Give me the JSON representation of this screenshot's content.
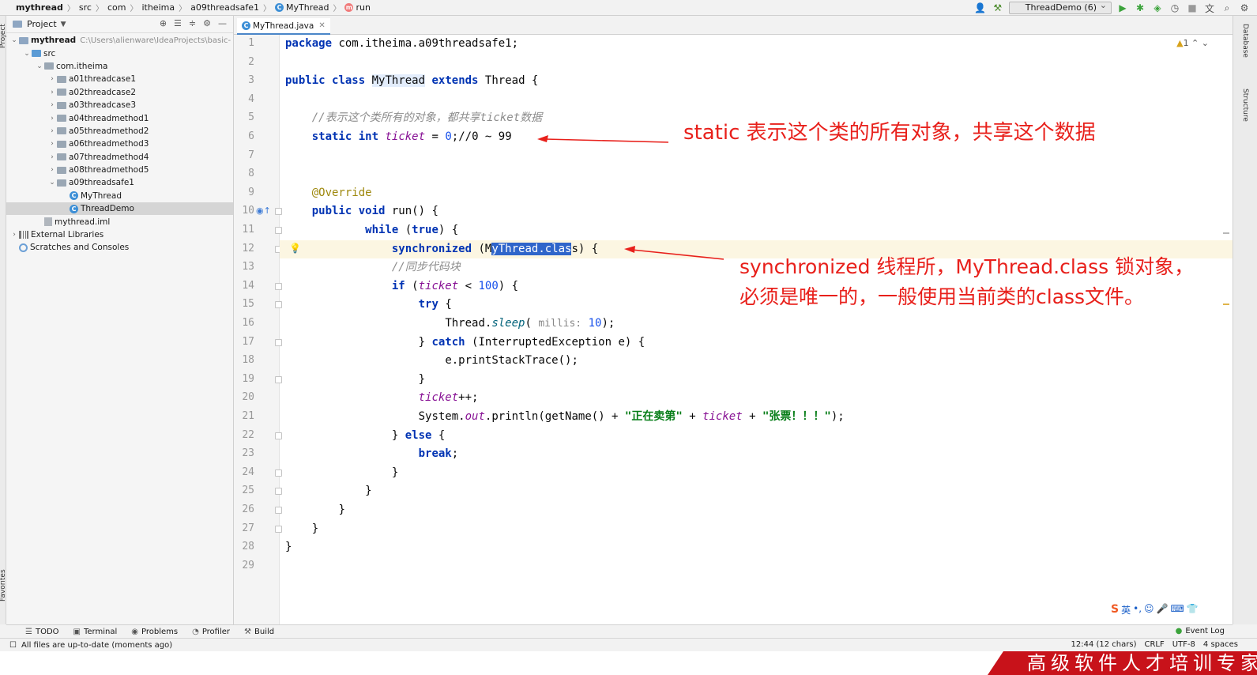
{
  "breadcrumb": [
    "mythread",
    "src",
    "com",
    "itheima",
    "a09threadsafe1",
    "MyThread",
    "run"
  ],
  "run_config": "ThreadDemo (6)",
  "project_panel": {
    "title": "Project",
    "root": {
      "name": "mythread",
      "path": "C:\\Users\\alienware\\IdeaProjects\\basic-"
    },
    "tree": [
      {
        "label": "src",
        "depth": 1,
        "type": "folder-blue",
        "expanded": true
      },
      {
        "label": "com.itheima",
        "depth": 2,
        "type": "pkg",
        "expanded": true
      },
      {
        "label": "a01threadcase1",
        "depth": 3,
        "type": "pkg",
        "expanded": false
      },
      {
        "label": "a02threadcase2",
        "depth": 3,
        "type": "pkg",
        "expanded": false
      },
      {
        "label": "a03threadcase3",
        "depth": 3,
        "type": "pkg",
        "expanded": false
      },
      {
        "label": "a04threadmethod1",
        "depth": 3,
        "type": "pkg",
        "expanded": false
      },
      {
        "label": "a05threadmethod2",
        "depth": 3,
        "type": "pkg",
        "expanded": false
      },
      {
        "label": "a06threadmethod3",
        "depth": 3,
        "type": "pkg",
        "expanded": false
      },
      {
        "label": "a07threadmethod4",
        "depth": 3,
        "type": "pkg",
        "expanded": false
      },
      {
        "label": "a08threadmethod5",
        "depth": 3,
        "type": "pkg",
        "expanded": false
      },
      {
        "label": "a09threadsafe1",
        "depth": 3,
        "type": "pkg",
        "expanded": true
      },
      {
        "label": "MyThread",
        "depth": 4,
        "type": "class"
      },
      {
        "label": "ThreadDemo",
        "depth": 4,
        "type": "class",
        "selected": true
      },
      {
        "label": "mythread.iml",
        "depth": 2,
        "type": "iml"
      },
      {
        "label": "External Libraries",
        "depth": 0,
        "type": "lib",
        "expanded": false
      },
      {
        "label": "Scratches and Consoles",
        "depth": 0,
        "type": "scratch"
      }
    ]
  },
  "editor": {
    "tab": "MyThread.java",
    "warnings": "1",
    "line_numbers": [
      "1",
      "2",
      "3",
      "4",
      "5",
      "6",
      "7",
      "8",
      "9",
      "10",
      "11",
      "12",
      "13",
      "14",
      "15",
      "16",
      "17",
      "18",
      "19",
      "20",
      "21",
      "22",
      "23",
      "24",
      "25",
      "26",
      "27",
      "28",
      "29"
    ]
  },
  "code": {
    "l1": [
      "package",
      " com.itheima.a09threadsafe1;"
    ],
    "l3": [
      "public",
      " ",
      "class",
      " ",
      "MyThread",
      " ",
      "extends",
      " Thread {"
    ],
    "l5": "//表示这个类所有的对象，都共享ticket数据",
    "l6": [
      "static",
      " ",
      "int",
      " ",
      "ticket",
      " = ",
      "0",
      ";//0 ~ 99"
    ],
    "l9": "@Override",
    "l10": [
      "public",
      " ",
      "void",
      " run() {"
    ],
    "l11": [
      "while",
      " (",
      "true",
      ") {"
    ],
    "l12": [
      "synchronized",
      " (M",
      "yThread.clas",
      "s) {"
    ],
    "l13": "//同步代码块",
    "l14": [
      "if",
      " (",
      "ticket",
      " < ",
      "100",
      ") {"
    ],
    "l15": [
      "try",
      " {"
    ],
    "l16": [
      "Thread.",
      "sleep",
      "( ",
      "millis:",
      " ",
      "10",
      ");"
    ],
    "l17": [
      "} ",
      "catch",
      " (InterruptedException e) {"
    ],
    "l18": "e.printStackTrace();",
    "l19": "}",
    "l20": [
      "ticket",
      "++;"
    ],
    "l21": [
      "System.",
      "out",
      ".println(getName() + ",
      "\"正在卖第\"",
      " + ",
      "ticket",
      " + ",
      "\"张票！！！\"",
      ");"
    ],
    "l22": [
      "} ",
      "else",
      " {"
    ],
    "l23": [
      "break",
      ";"
    ],
    "l24": "}",
    "l25": "}",
    "l26": "}",
    "l27": "}",
    "l28": "}"
  },
  "annotations": {
    "static_note": "static 表示这个类的所有对象，共享这个数据",
    "sync_note_1": "synchronized 线程所，MyThread.class 锁对象，",
    "sync_note_2": "必须是唯一的，一般使用当前类的class文件。"
  },
  "left_strip": {
    "project": "Project",
    "favorites": "Favorites"
  },
  "right_strip": {
    "database": "Database",
    "structure": "Structure"
  },
  "tool_windows": [
    "TODO",
    "Terminal",
    "Problems",
    "Profiler",
    "Build"
  ],
  "event_log": "Event Log",
  "status": {
    "message": "All files are up-to-date (moments ago)",
    "position": "12:44 (12 chars)",
    "line_sep": "CRLF",
    "encoding": "UTF-8",
    "indent": "4 spaces"
  },
  "ime": {
    "brand": "S",
    "lang": "英"
  },
  "banner": "高级软件人才培训专家",
  "colors": {
    "annotation": "#e8201b",
    "keyword": "#0033b3",
    "selection": "#2f65ca",
    "banner": "#c8121a"
  }
}
